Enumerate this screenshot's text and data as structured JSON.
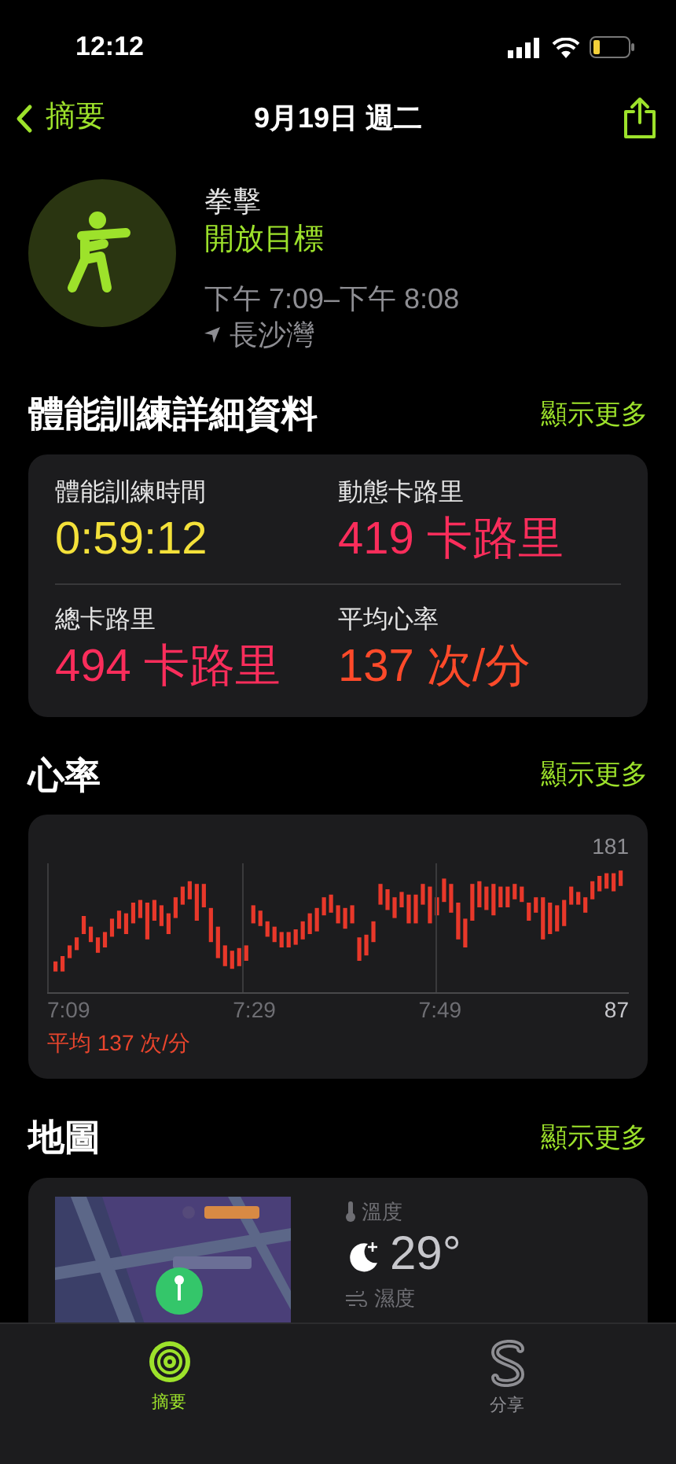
{
  "status_bar": {
    "time": "12:12"
  },
  "nav": {
    "back": "摘要",
    "title": "9月19日 週二"
  },
  "workout": {
    "name": "拳擊",
    "goal": "開放目標",
    "time_range": "下午 7:09–下午 8:08",
    "location": "長沙灣"
  },
  "details": {
    "title": "體能訓練詳細資料",
    "more": "顯示更多",
    "stats": [
      {
        "label": "體能訓練時間",
        "value": "0:59:12",
        "color": "#f4e13a"
      },
      {
        "label": "動態卡路里",
        "value": "419 卡路里",
        "color": "#fa2d5b"
      },
      {
        "label": "總卡路里",
        "value": "494 卡路里",
        "color": "#fa2d5b"
      },
      {
        "label": "平均心率",
        "value": "137 次/分",
        "color": "#ff4a2a"
      }
    ]
  },
  "heart_rate": {
    "title": "心率",
    "more": "顯示更多",
    "max_label": "181",
    "min_label": "87",
    "time_labels": [
      "7:09",
      "7:29",
      "7:49"
    ],
    "average": "平均 137 次/分"
  },
  "map": {
    "title": "地圖",
    "more": "顯示更多",
    "temperature_label": "溫度",
    "temperature": "29°",
    "humidity_label": "濕度"
  },
  "tab_bar": [
    {
      "label": "摘要",
      "kind": "summary",
      "selected": true
    },
    {
      "label": "分享",
      "kind": "sharing",
      "selected": false
    }
  ]
}
